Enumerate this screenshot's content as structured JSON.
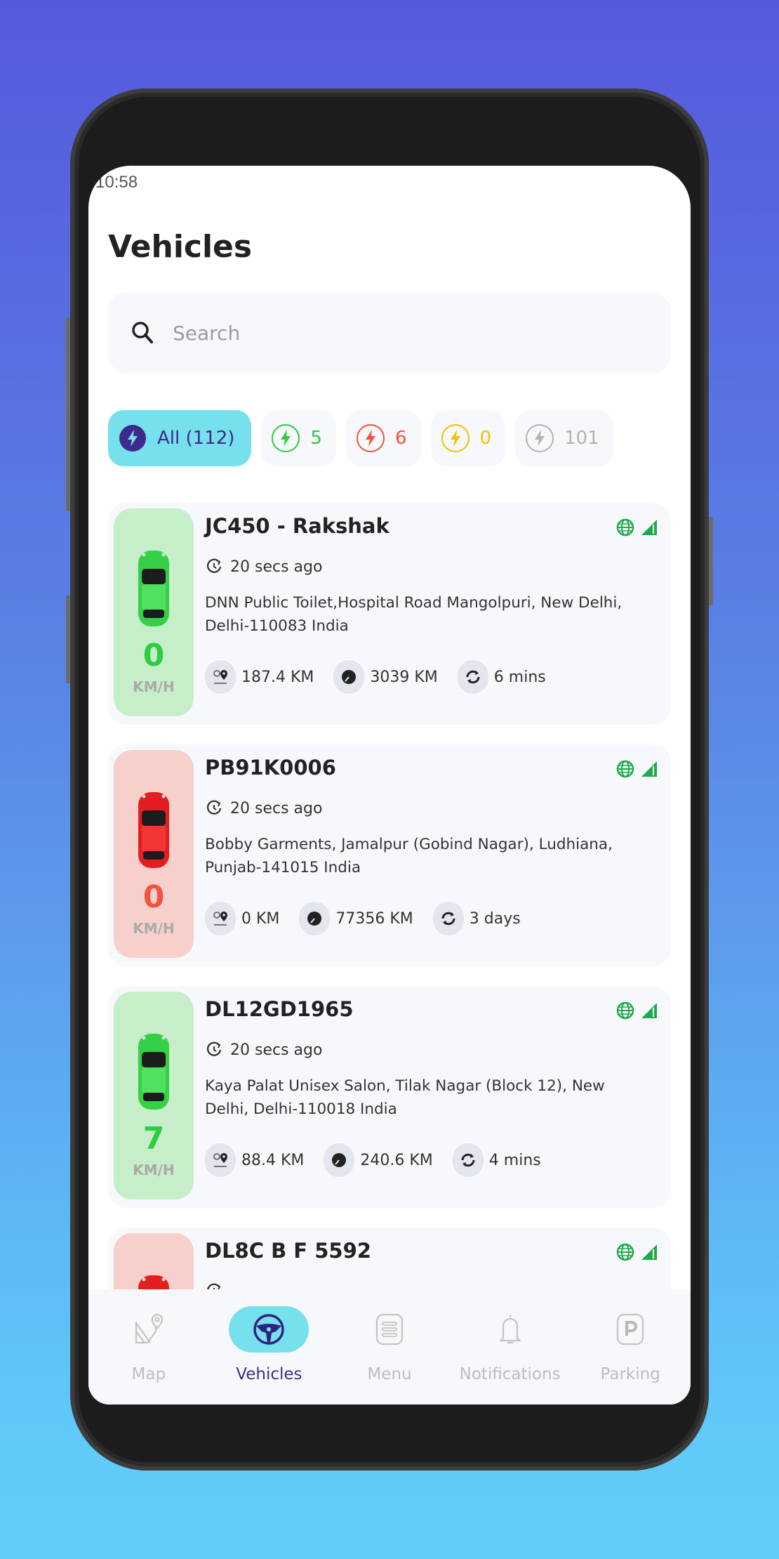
{
  "status_bar": {
    "time": "10:58"
  },
  "header": {
    "title": "Vehicles"
  },
  "search": {
    "placeholder": "Search",
    "value": ""
  },
  "filters": [
    {
      "id": "all",
      "label": "All (112)",
      "color": "#3d2a8c",
      "icon": "bolt-icon",
      "active": true
    },
    {
      "id": "running",
      "label": "5",
      "color": "#2ecc40",
      "icon": "bolt-icon",
      "active": false
    },
    {
      "id": "stopped",
      "label": "6",
      "color": "#f0533f",
      "icon": "bolt-icon",
      "active": false
    },
    {
      "id": "idle",
      "label": "0",
      "color": "#f5c000",
      "icon": "bolt-icon",
      "active": false
    },
    {
      "id": "offline",
      "label": "101",
      "color": "#b3b3b3",
      "icon": "bolt-icon",
      "active": false
    }
  ],
  "vehicles": [
    {
      "name": "JC450 - Rakshak",
      "status": "running",
      "status_color": "#2ecc40",
      "speed": "0",
      "speed_unit": "KM/H",
      "last_update": "20 secs ago",
      "address": "DNN Public Toilet,Hospital Road Mangolpuri, New Delhi, Delhi-110083 India",
      "distance": "187.4 KM",
      "odometer": "3039 KM",
      "duration": "6 mins"
    },
    {
      "name": "PB91K0006",
      "status": "stopped",
      "status_color": "#f0533f",
      "speed": "0",
      "speed_unit": "KM/H",
      "last_update": "20 secs ago",
      "address": "Bobby Garments, Jamalpur (Gobind Nagar), Ludhiana, Punjab-141015 India",
      "distance": "0 KM",
      "odometer": "77356 KM",
      "duration": "3 days"
    },
    {
      "name": "DL12GD1965",
      "status": "running",
      "status_color": "#2ecc40",
      "speed": "7",
      "speed_unit": "KM/H",
      "last_update": "20 secs ago",
      "address": "Kaya Palat Unisex Salon, Tilak Nagar (Block 12), New Delhi, Delhi-110018 India",
      "distance": "88.4 KM",
      "odometer": "240.6 KM",
      "duration": "4 mins"
    },
    {
      "name": "DL8C B F 5592",
      "status": "stopped",
      "status_color": "#f0533f"
    }
  ],
  "bottom_nav": [
    {
      "label": "Map",
      "icon": "map-icon",
      "active": false
    },
    {
      "label": "Vehicles",
      "icon": "steering-wheel-icon",
      "active": true
    },
    {
      "label": "Menu",
      "icon": "menu-icon",
      "active": false
    },
    {
      "label": "Notifications",
      "icon": "bell-icon",
      "active": false
    },
    {
      "label": "Parking",
      "icon": "parking-icon",
      "active": false
    }
  ],
  "colors": {
    "accent_active": "#76e1ec",
    "primary_dark": "#3d2a8c",
    "online_green": "#1faa4a"
  }
}
